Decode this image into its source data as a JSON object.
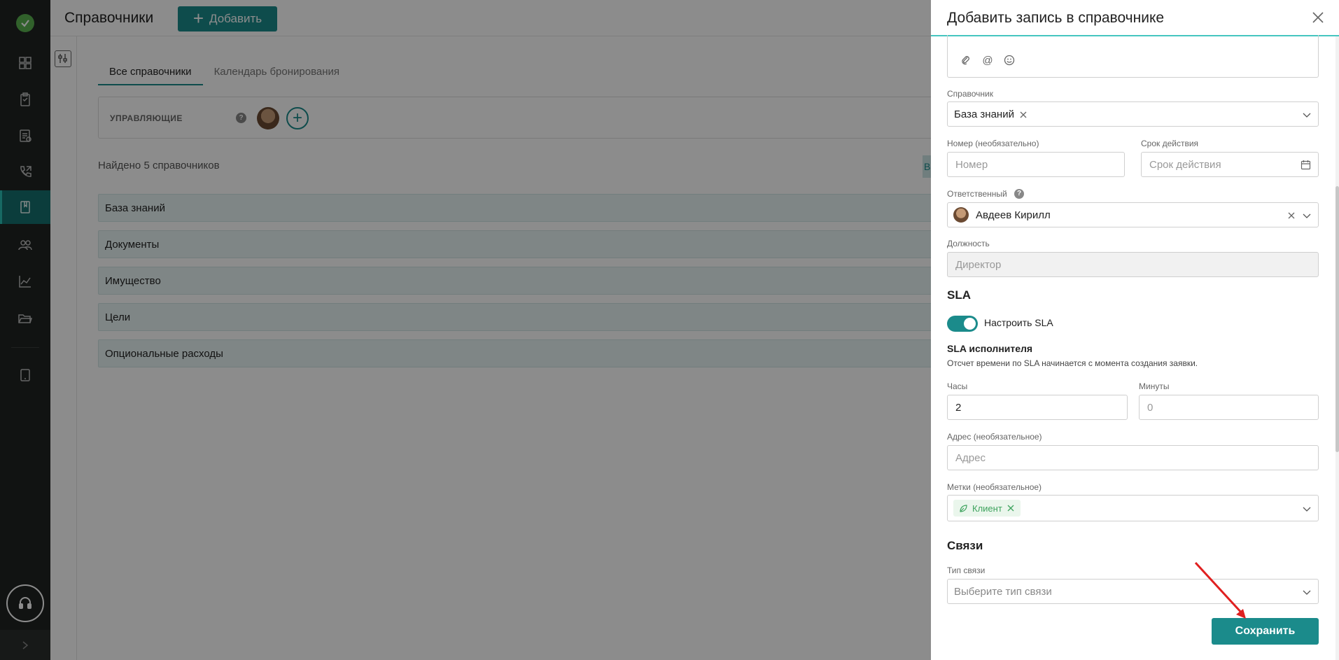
{
  "header": {
    "title": "Справочники",
    "add_label": "Добавить"
  },
  "tabs": [
    {
      "label": "Все справочники",
      "active": true
    },
    {
      "label": "Календарь бронирования",
      "active": false
    }
  ],
  "managers": {
    "label": "УПРАВЛЯЮЩИЕ",
    "help": "?"
  },
  "found_text": "Найдено 5 справочников",
  "hidden_chip": "В",
  "list": [
    "База знаний",
    "Документы",
    "Имущество",
    "Цели",
    "Опциональные расходы"
  ],
  "panel": {
    "title": "Добавить запись в справочнике",
    "editor_icons": [
      "paperclip-icon",
      "at-icon",
      "smile-icon"
    ],
    "directory": {
      "label": "Справочник",
      "value": "База знаний"
    },
    "number": {
      "label": "Номер (необязательно)",
      "placeholder": "Номер"
    },
    "validity": {
      "label": "Срок действия",
      "placeholder": "Срок действия"
    },
    "responsible": {
      "label": "Ответственный",
      "help": "?",
      "value": "Авдеев Кирилл"
    },
    "position": {
      "label": "Должность",
      "placeholder": "Директор"
    },
    "sla": {
      "title": "SLA",
      "toggle_label": "Настроить SLA",
      "toggle_on": true,
      "executor_title": "SLA исполнителя",
      "executor_desc": "Отсчет времени по SLA начинается с момента создания заявки.",
      "hours": {
        "label": "Часы",
        "value": "2"
      },
      "minutes": {
        "label": "Минуты",
        "placeholder": "0"
      }
    },
    "address": {
      "label": "Адрес (необязательное)",
      "placeholder": "Адрес"
    },
    "tags": {
      "label": "Метки (необязательное)",
      "chip": "Клиент"
    },
    "links": {
      "title": "Связи",
      "type_label": "Тип связи",
      "type_placeholder": "Выберите тип связи"
    },
    "save_label": "Сохранить"
  },
  "colors": {
    "accent": "#1b8b8b",
    "nav_bg": "#1f2422",
    "annotation_arrow": "#e02020"
  }
}
